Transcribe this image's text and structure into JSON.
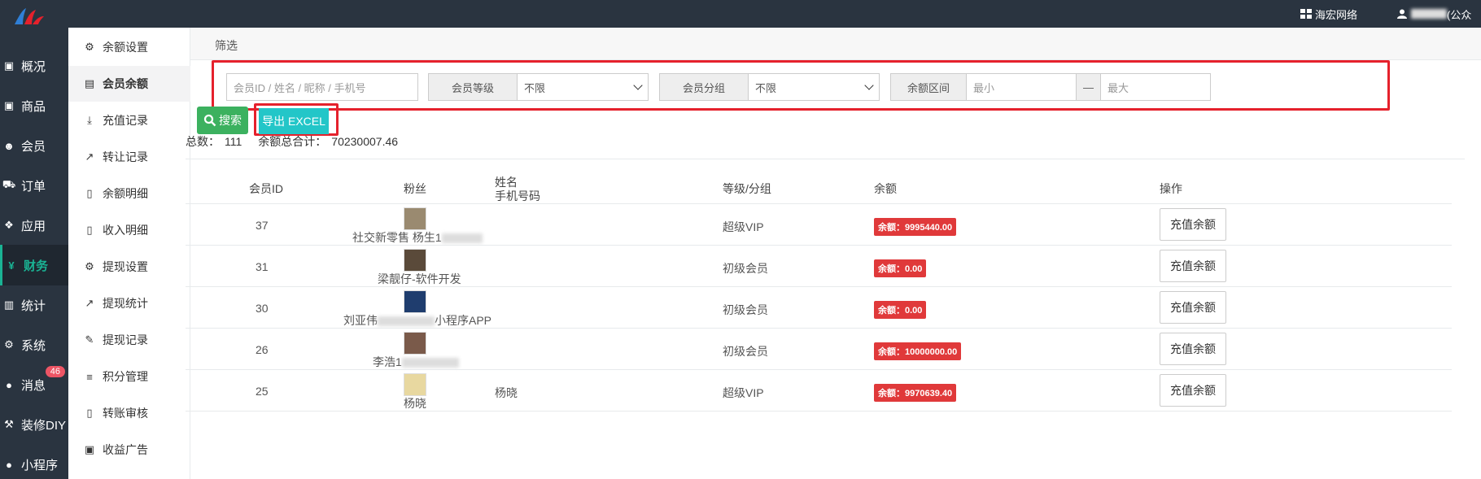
{
  "top": {
    "org": "海宏网络",
    "user": "(公众"
  },
  "leftnav": [
    {
      "label": "概况",
      "icon": "dashboard-icon",
      "glyph": "▣"
    },
    {
      "label": "商品",
      "icon": "product-icon",
      "glyph": "▣"
    },
    {
      "label": "会员",
      "icon": "users-icon",
      "glyph": "👥"
    },
    {
      "label": "订单",
      "icon": "cart-icon",
      "glyph": "🛒"
    },
    {
      "label": "应用",
      "icon": "apps-icon",
      "glyph": "❖"
    },
    {
      "label": "财务",
      "icon": "yen-icon",
      "glyph": "¥"
    },
    {
      "label": "统计",
      "icon": "bar-chart-icon",
      "glyph": "▥"
    },
    {
      "label": "系统",
      "icon": "gears-icon",
      "glyph": "⚙"
    },
    {
      "label": "消息",
      "icon": "chat-icon",
      "glyph": "●"
    },
    {
      "label": "装修DIY",
      "icon": "hammer-icon",
      "glyph": "⚒"
    },
    {
      "label": "小程序",
      "icon": "miniapp-icon",
      "glyph": "●"
    }
  ],
  "message_badge": "46",
  "subnav": [
    {
      "label": "余额设置",
      "icon": "gear-icon",
      "glyph": "⚙"
    },
    {
      "label": "会员余额",
      "icon": "book-icon",
      "glyph": "▤"
    },
    {
      "label": "充值记录",
      "icon": "download-icon",
      "glyph": "⤓"
    },
    {
      "label": "转让记录",
      "icon": "external-link-icon",
      "glyph": "↗"
    },
    {
      "label": "余额明细",
      "icon": "file-icon",
      "glyph": "▯"
    },
    {
      "label": "收入明细",
      "icon": "file-icon",
      "glyph": "▯"
    },
    {
      "label": "提现设置",
      "icon": "gear-icon",
      "glyph": "⚙"
    },
    {
      "label": "提现统计",
      "icon": "line-chart-icon",
      "glyph": "↗"
    },
    {
      "label": "提现记录",
      "icon": "pencil-icon",
      "glyph": "✎"
    },
    {
      "label": "积分管理",
      "icon": "database-icon",
      "glyph": "≡"
    },
    {
      "label": "转账审核",
      "icon": "file-icon",
      "glyph": "▯"
    },
    {
      "label": "收益广告",
      "icon": "image-icon",
      "glyph": "▣"
    }
  ],
  "filter": {
    "title": "筛选",
    "search_placeholder": "会员ID / 姓名 / 昵称 / 手机号",
    "level_label": "会员等级",
    "level_value": "不限",
    "group_label": "会员分组",
    "group_value": "不限",
    "range_label": "余额区间",
    "min_placeholder": "最小",
    "dash": "—",
    "max_placeholder": "最大",
    "search_button": "搜索",
    "export_button": "导出 EXCEL"
  },
  "summary": {
    "total_label": "总数：",
    "total_value": "111",
    "sum_label": "余额总合计：",
    "sum_value": "70230007.46"
  },
  "table": {
    "headers": {
      "id": "会员ID",
      "fans": "粉丝",
      "name": "姓名",
      "phone": "手机号码",
      "level": "等级/分组",
      "balance": "余额",
      "action": "操作"
    },
    "rows": [
      {
        "id": "37",
        "fan": "社交新零售 杨生1",
        "name": "",
        "level": "超级VIP",
        "balance": "余额：9995440.00",
        "action": "充值余额"
      },
      {
        "id": "31",
        "fan": "梁靓仔-软件开发",
        "name": "",
        "level": "初级会员",
        "balance": "余额：0.00",
        "action": "充值余额"
      },
      {
        "id": "30",
        "fan": "刘亚伟",
        "fan_suffix": "小程序APP",
        "name": "",
        "level": "初级会员",
        "balance": "余额：0.00",
        "action": "充值余额"
      },
      {
        "id": "26",
        "fan": "李浩1",
        "name": "",
        "level": "初级会员",
        "balance": "余额：10000000.00",
        "action": "充值余额"
      },
      {
        "id": "25",
        "fan": "杨晓",
        "name": "杨晓",
        "level": "超级VIP",
        "balance": "余额：9970639.40",
        "action": "充值余额"
      }
    ]
  }
}
